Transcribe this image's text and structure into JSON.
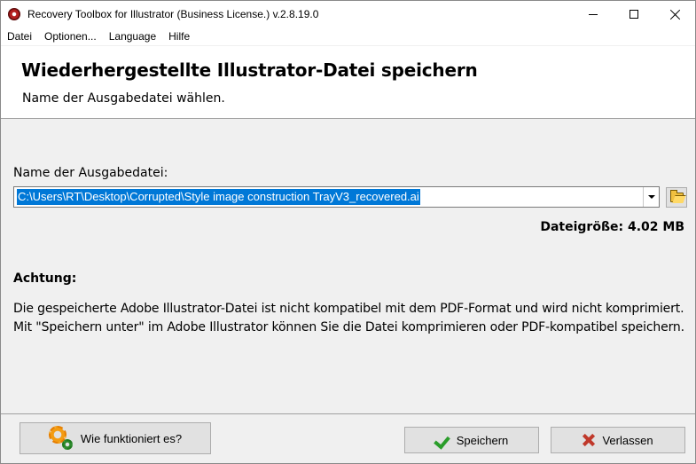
{
  "window": {
    "title": "Recovery Toolbox for Illustrator (Business License.) v.2.8.19.0"
  },
  "menu": {
    "items": [
      {
        "label": "Datei"
      },
      {
        "label": "Optionen..."
      },
      {
        "label": "Language"
      },
      {
        "label": "Hilfe"
      }
    ]
  },
  "header": {
    "title": "Wiederhergestellte Illustrator-Datei speichern",
    "subtitle": "Name der Ausgabedatei wählen."
  },
  "output": {
    "label": "Name der Ausgabedatei:",
    "value": "C:\\Users\\RT\\Desktop\\Corrupted\\Style image construction TrayV3_recovered.ai",
    "filesize": "Dateigröße: 4.02 MB"
  },
  "warning": {
    "title": "Achtung:",
    "line1": "Die gespeicherte Adobe Illustrator-Datei ist nicht kompatibel mit dem PDF-Format und wird nicht komprimiert.",
    "line2": "Mit \"Speichern unter\" im Adobe Illustrator können Sie die Datei komprimieren oder PDF-kompatibel speichern."
  },
  "footer": {
    "help_label": "Wie funktioniert es?",
    "save_label": "Speichern",
    "quit_label": "Verlassen"
  },
  "colors": {
    "selection": "#0078d7",
    "check": "#2a9d2a",
    "cross": "#c0392b"
  },
  "icons": {
    "app": "app-icon",
    "browse": "folder-open-icon",
    "help": "gears-icon",
    "save": "checkmark-icon",
    "quit": "x-icon"
  }
}
